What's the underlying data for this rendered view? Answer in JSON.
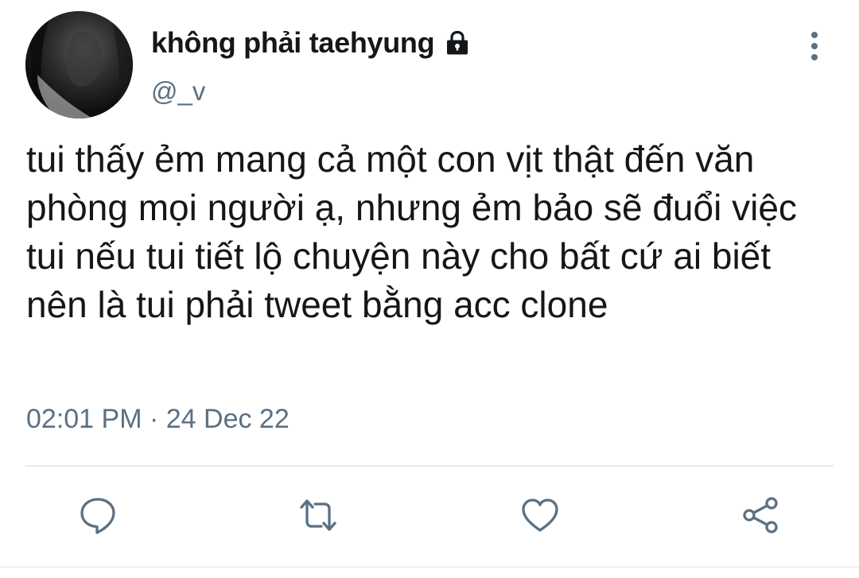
{
  "author": {
    "display_name": "không phải taehyung",
    "handle": "@_v",
    "protected_icon": "lock-icon",
    "avatar_icon": "profile-photo"
  },
  "tweet": {
    "text": "tui thấy ẻm mang cả một con vịt thật đến văn phòng mọi người ạ, nhưng ẻm bảo sẽ đuổi việc tui nếu tui tiết lộ chuyện này cho bất cứ ai biết nên là tui phải tweet bằng acc clone",
    "timestamp": "02:01 PM · 24 Dec 22"
  },
  "menu": {
    "icon": "more-vertical-icon"
  },
  "actions": [
    {
      "name": "reply",
      "icon": "comment-icon"
    },
    {
      "name": "retweet",
      "icon": "retweet-icon"
    },
    {
      "name": "like",
      "icon": "heart-icon"
    },
    {
      "name": "share",
      "icon": "share-icon"
    }
  ],
  "colors": {
    "text_primary": "#14171a",
    "text_secondary": "#5b7083",
    "icon": "#5b7083",
    "divider": "#e6ecf0",
    "background": "#ffffff"
  }
}
